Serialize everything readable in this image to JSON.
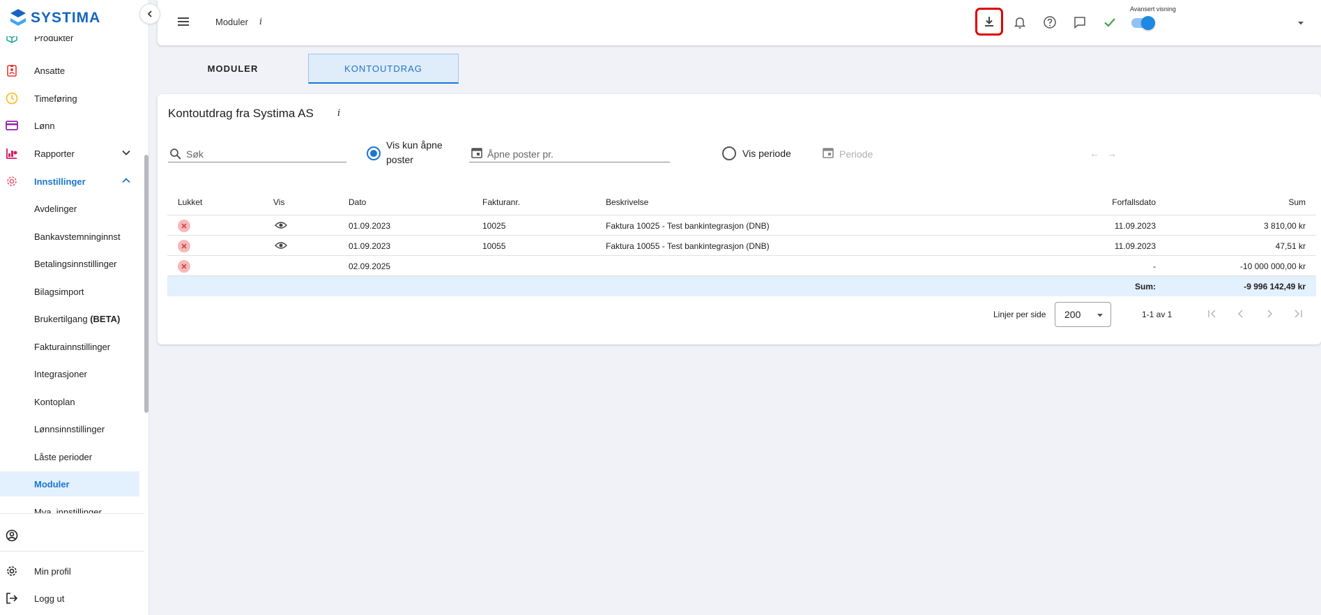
{
  "brand": {
    "name": "SYSTIMA",
    "color": "#1565c0"
  },
  "sidebar": {
    "items": [
      {
        "label": "Produkter",
        "icon": "cube-icon"
      },
      {
        "label": "Ansatte",
        "icon": "badge-icon"
      },
      {
        "label": "Timeføring",
        "icon": "clock-icon"
      },
      {
        "label": "Lønn",
        "icon": "card-icon"
      },
      {
        "label": "Rapporter",
        "icon": "report-icon"
      },
      {
        "label": "Innstillinger",
        "icon": "gear-icon"
      }
    ],
    "sub_items": [
      "Avdelinger",
      "Bankavstemninginnst",
      "Betalingsinnstillinger",
      "Bilagsimport",
      "Brukertilgang ",
      "Fakturainnstillinger",
      "Integrasjoner",
      "Kontoplan",
      "Lønnsinnstillinger",
      "Låste perioder",
      "Moduler",
      "Mva. innstillinger"
    ],
    "beta_tag": "(BETA)",
    "bottom": {
      "profile": "Min profil",
      "logout": "Logg ut"
    }
  },
  "topbar": {
    "breadcrumb": "Moduler",
    "info": "i",
    "advanced_view_label": "Avansert visning"
  },
  "tabs": [
    "MODULER",
    "KONTOUTDRAG"
  ],
  "card": {
    "title": "Kontoutdrag fra Systima AS",
    "info": "i",
    "search_placeholder": "Søk",
    "radio_open_label_1": "Vis kun åpne",
    "radio_open_label_2": "poster",
    "open_date_placeholder": "Åpne poster pr.",
    "radio_period_label": "Vis periode",
    "period_placeholder": "Periode"
  },
  "table": {
    "headers": [
      "Lukket",
      "Vis",
      "Dato",
      "Fakturanr.",
      "Beskrivelse",
      "Forfallsdato",
      "Sum"
    ],
    "rows": [
      {
        "dato": "01.09.2023",
        "fakturanr": "10025",
        "beskrivelse": "Faktura 10025 - Test bankintegrasjon (DNB)",
        "forfall": "11.09.2023",
        "sum": "3 810,00 kr"
      },
      {
        "dato": "01.09.2023",
        "fakturanr": "10055",
        "beskrivelse": "Faktura 10055 - Test bankintegrasjon (DNB)",
        "forfall": "11.09.2023",
        "sum": "47,51 kr"
      },
      {
        "dato": "02.09.2025",
        "fakturanr": "",
        "beskrivelse": "",
        "forfall": "-",
        "sum": "-10 000 000,00 kr"
      }
    ],
    "sum_label": "Sum:",
    "sum_value": "-9 996 142,49 kr"
  },
  "pagination": {
    "rows_label": "Linjer per side",
    "rows_value": "200",
    "range": "1-1 av 1"
  },
  "colors": {
    "accent": "#1976d2",
    "highlight": "#e00000",
    "close_badge": "#f6b9b9"
  }
}
